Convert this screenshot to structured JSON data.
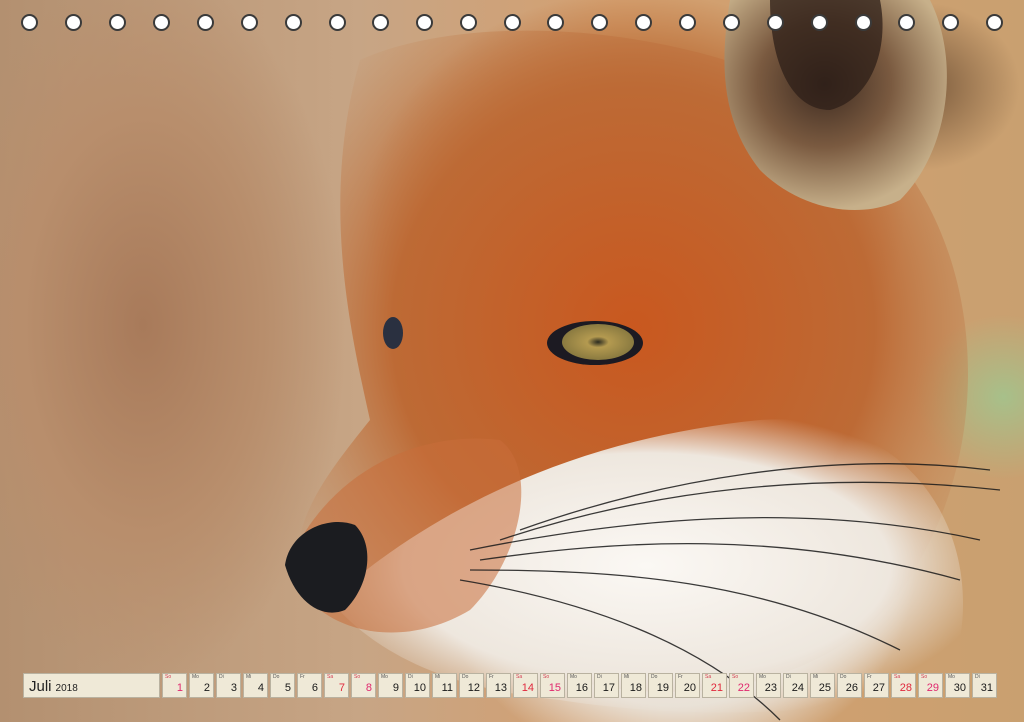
{
  "photo": {
    "subject": "red-fox-portrait"
  },
  "colors": {
    "weekend_saturday": "#e0283c",
    "weekend_sunday": "#e0286e",
    "cell_bg": "#efe9d7"
  },
  "calendar": {
    "month": "Juli",
    "year": "2018",
    "days": [
      {
        "wd": "So",
        "n": "1"
      },
      {
        "wd": "Mo",
        "n": "2"
      },
      {
        "wd": "Di",
        "n": "3"
      },
      {
        "wd": "Mi",
        "n": "4"
      },
      {
        "wd": "Do",
        "n": "5"
      },
      {
        "wd": "Fr",
        "n": "6"
      },
      {
        "wd": "Sa",
        "n": "7"
      },
      {
        "wd": "So",
        "n": "8"
      },
      {
        "wd": "Mo",
        "n": "9"
      },
      {
        "wd": "Di",
        "n": "10"
      },
      {
        "wd": "Mi",
        "n": "11"
      },
      {
        "wd": "Do",
        "n": "12"
      },
      {
        "wd": "Fr",
        "n": "13"
      },
      {
        "wd": "Sa",
        "n": "14"
      },
      {
        "wd": "So",
        "n": "15"
      },
      {
        "wd": "Mo",
        "n": "16"
      },
      {
        "wd": "Di",
        "n": "17"
      },
      {
        "wd": "Mi",
        "n": "18"
      },
      {
        "wd": "Do",
        "n": "19"
      },
      {
        "wd": "Fr",
        "n": "20"
      },
      {
        "wd": "Sa",
        "n": "21"
      },
      {
        "wd": "So",
        "n": "22"
      },
      {
        "wd": "Mo",
        "n": "23"
      },
      {
        "wd": "Di",
        "n": "24"
      },
      {
        "wd": "Mi",
        "n": "25"
      },
      {
        "wd": "Do",
        "n": "26"
      },
      {
        "wd": "Fr",
        "n": "27"
      },
      {
        "wd": "Sa",
        "n": "28"
      },
      {
        "wd": "So",
        "n": "29"
      },
      {
        "wd": "Mo",
        "n": "30"
      },
      {
        "wd": "Di",
        "n": "31"
      }
    ]
  }
}
